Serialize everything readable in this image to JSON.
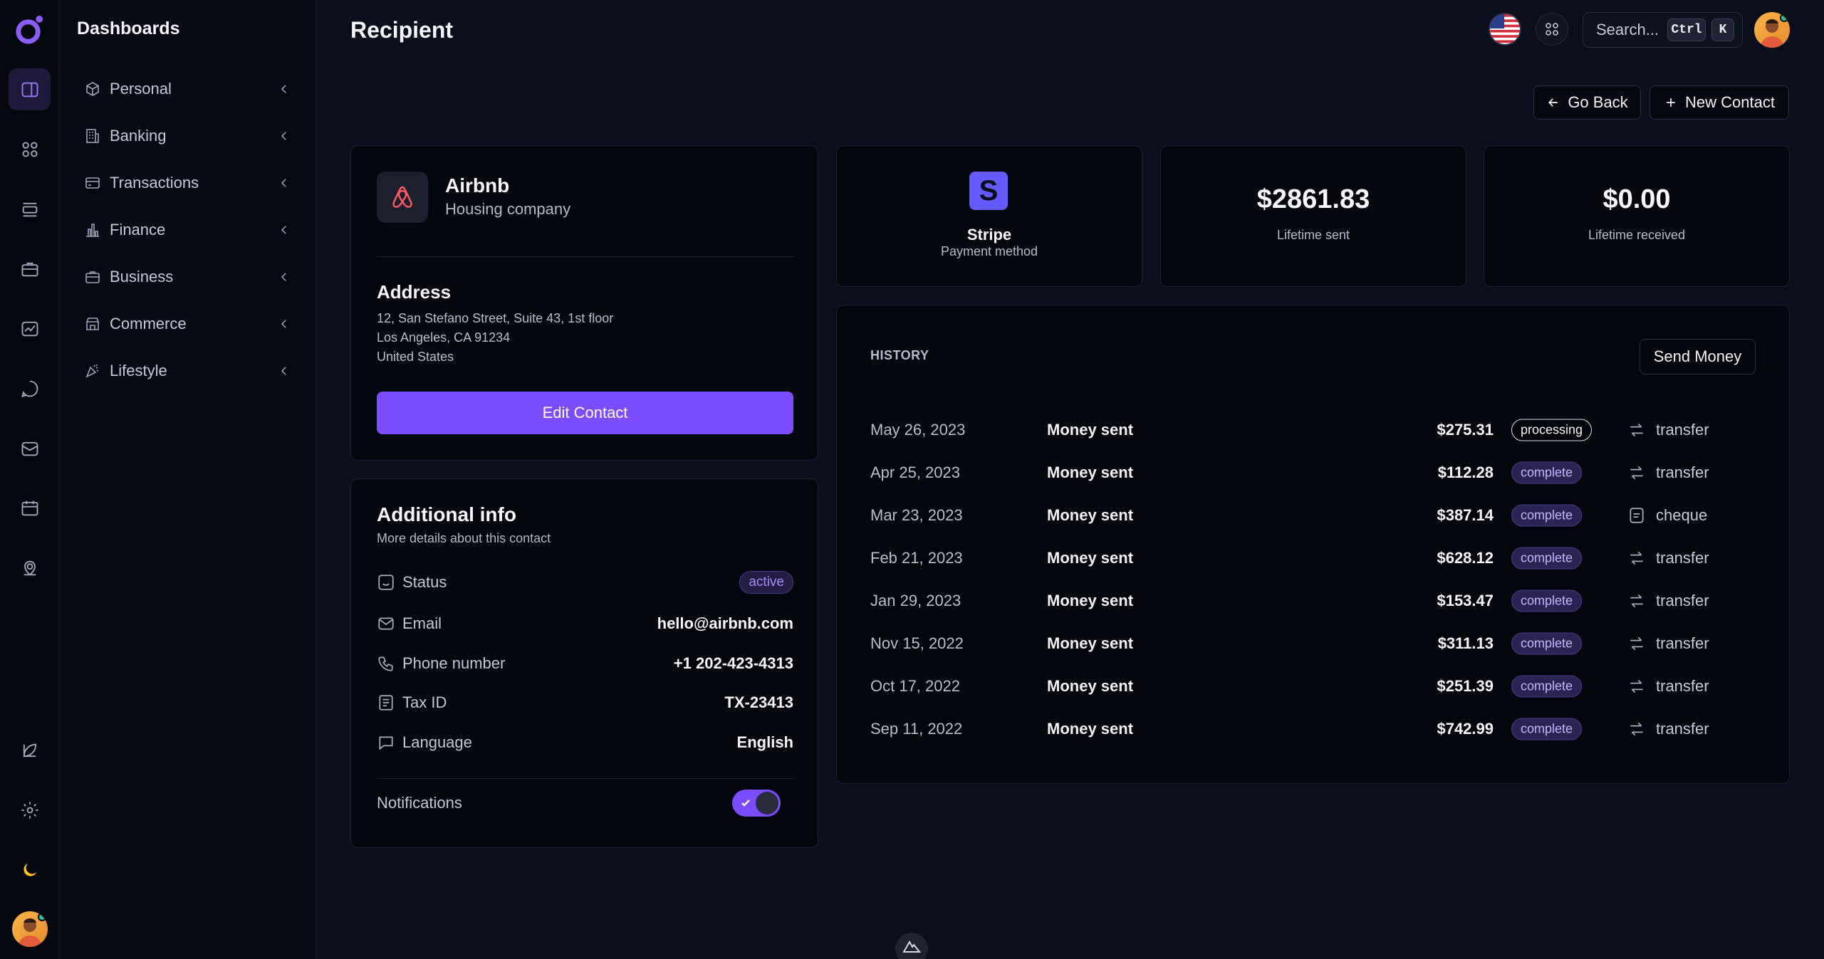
{
  "sidebar": {
    "title": "Dashboards",
    "items": [
      {
        "label": "Personal",
        "icon": "box-icon"
      },
      {
        "label": "Banking",
        "icon": "building-icon"
      },
      {
        "label": "Transactions",
        "icon": "credit-card-icon"
      },
      {
        "label": "Finance",
        "icon": "bar-chart-icon"
      },
      {
        "label": "Business",
        "icon": "briefcase-icon"
      },
      {
        "label": "Commerce",
        "icon": "shop-icon"
      },
      {
        "label": "Lifestyle",
        "icon": "party-icon"
      }
    ]
  },
  "rail": {
    "icons": [
      "sidebar-layout-icon",
      "grid-icon",
      "list-icon",
      "briefcase-icon",
      "chart-icon",
      "chat-icon",
      "inbox-icon",
      "calendar-icon",
      "map-pin-icon",
      "leaf-icon",
      "gear-icon",
      "moon-icon"
    ]
  },
  "header": {
    "title": "Recipient",
    "search_placeholder": "Search...",
    "kbd_ctrl": "Ctrl",
    "kbd_k": "K"
  },
  "actions": {
    "go_back": "Go Back",
    "new_contact": "New Contact"
  },
  "contact": {
    "name": "Airbnb",
    "type": "Housing company",
    "address_title": "Address",
    "address_lines": [
      "12, San Stefano Street, Suite 43, 1st floor",
      "Los Angeles, CA 91234",
      "United States"
    ],
    "edit_label": "Edit Contact"
  },
  "info": {
    "title": "Additional info",
    "subtitle": "More details about this contact",
    "rows": [
      {
        "label": "Status",
        "value": "active"
      },
      {
        "label": "Email",
        "value": "hello@airbnb.com"
      },
      {
        "label": "Phone number",
        "value": "+1 202-423-4313"
      },
      {
        "label": "Tax ID",
        "value": "TX-23413"
      },
      {
        "label": "Language",
        "value": "English"
      }
    ],
    "notifications_label": "Notifications",
    "notifications_on": true
  },
  "stats": {
    "payment_logo": "S",
    "payment_name": "Stripe",
    "payment_label": "Payment method",
    "sent_value": "$2861.83",
    "sent_label": "Lifetime sent",
    "received_value": "$0.00",
    "received_label": "Lifetime received"
  },
  "history": {
    "title": "HISTORY",
    "send_label": "Send Money",
    "rows": [
      {
        "date": "May 26, 2023",
        "desc": "Money sent",
        "amount": "$275.31",
        "status": "processing",
        "method": "transfer"
      },
      {
        "date": "Apr 25, 2023",
        "desc": "Money sent",
        "amount": "$112.28",
        "status": "complete",
        "method": "transfer"
      },
      {
        "date": "Mar 23, 2023",
        "desc": "Money sent",
        "amount": "$387.14",
        "status": "complete",
        "method": "cheque"
      },
      {
        "date": "Feb 21, 2023",
        "desc": "Money sent",
        "amount": "$628.12",
        "status": "complete",
        "method": "transfer"
      },
      {
        "date": "Jan 29, 2023",
        "desc": "Money sent",
        "amount": "$153.47",
        "status": "complete",
        "method": "transfer"
      },
      {
        "date": "Nov 15, 2022",
        "desc": "Money sent",
        "amount": "$311.13",
        "status": "complete",
        "method": "transfer"
      },
      {
        "date": "Oct 17, 2022",
        "desc": "Money sent",
        "amount": "$251.39",
        "status": "complete",
        "method": "transfer"
      },
      {
        "date": "Sep 11, 2022",
        "desc": "Money sent",
        "amount": "$742.99",
        "status": "complete",
        "method": "transfer"
      }
    ]
  },
  "colors": {
    "accent": "#7c4dff",
    "background": "#0b0e1c",
    "card": "#04060d",
    "stripe": "#635bff",
    "airbnb": "#ff5a5f"
  }
}
